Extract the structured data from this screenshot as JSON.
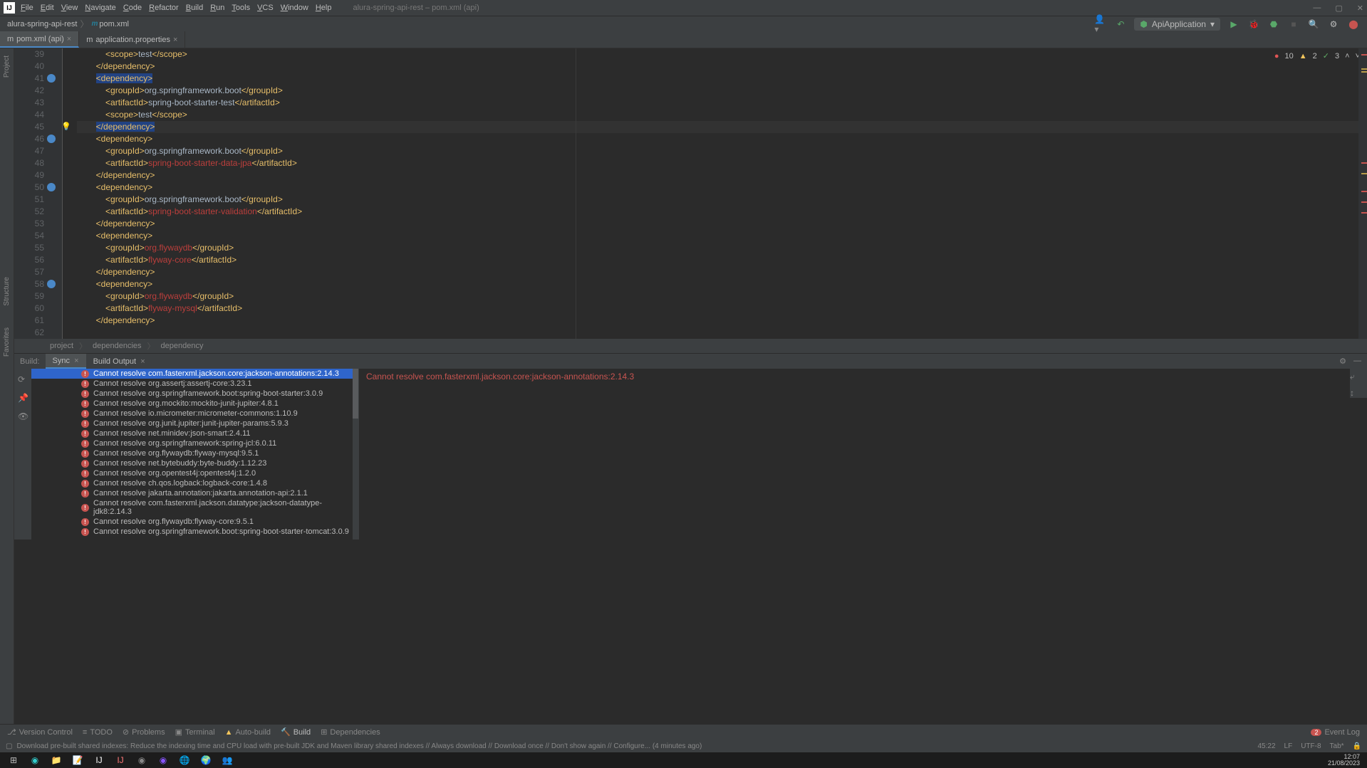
{
  "menus": [
    "File",
    "Edit",
    "View",
    "Navigate",
    "Code",
    "Refactor",
    "Build",
    "Run",
    "Tools",
    "VCS",
    "Window",
    "Help"
  ],
  "window_title": "alura-spring-api-rest – pom.xml (api)",
  "breadcrumb": {
    "project": "alura-spring-api-rest",
    "file": "pom.xml"
  },
  "run_config": "ApiApplication",
  "tabs": [
    {
      "label": "pom.xml (api)",
      "active": true
    },
    {
      "label": "application.properties",
      "active": false
    }
  ],
  "inspections": {
    "errors": "10",
    "warnings": "2",
    "ok": "3"
  },
  "code_lines": [
    {
      "n": 39,
      "html": "            <span class='tag'>&lt;scope&gt;</span><span class='txt'>test</span><span class='tag'>&lt;/scope&gt;</span>"
    },
    {
      "n": 40,
      "html": "        <span class='tag'>&lt;/dependency&gt;</span>"
    },
    {
      "n": 41,
      "html": "        <span class='tag highlighted-tag'>&lt;dependency&gt;</span>",
      "gicon": true
    },
    {
      "n": 42,
      "html": "            <span class='tag'>&lt;groupId&gt;</span><span class='txt'>org.springframework.boot</span><span class='tag'>&lt;/groupId&gt;</span>"
    },
    {
      "n": 43,
      "html": "            <span class='tag'>&lt;artifactId&gt;</span><span class='txt'>spring-boot-starter-test</span><span class='tag'>&lt;/artifactId&gt;</span>"
    },
    {
      "n": 44,
      "html": "            <span class='tag'>&lt;scope&gt;</span><span class='txt'>test</span><span class='tag'>&lt;/scope&gt;</span>"
    },
    {
      "n": 45,
      "html": "        <span class='tag highlighted-tag'>&lt;/dependency&gt;</span>",
      "hl": true,
      "bulb": true
    },
    {
      "n": 46,
      "html": "        <span class='tag'>&lt;dependency&gt;</span>",
      "gicon": true
    },
    {
      "n": 47,
      "html": "            <span class='tag'>&lt;groupId&gt;</span><span class='txt'>org.springframework.boot</span><span class='tag'>&lt;/groupId&gt;</span>"
    },
    {
      "n": 48,
      "html": "            <span class='tag'>&lt;artifactId&gt;</span><span class='red'>spring-boot-starter-data-jpa</span><span class='tag'>&lt;/artifactId&gt;</span>"
    },
    {
      "n": 49,
      "html": "        <span class='tag'>&lt;/dependency&gt;</span>"
    },
    {
      "n": 50,
      "html": "        <span class='tag'>&lt;dependency&gt;</span>",
      "gicon": true
    },
    {
      "n": 51,
      "html": "            <span class='tag'>&lt;groupId&gt;</span><span class='txt'>org.springframework.boot</span><span class='tag'>&lt;/groupId&gt;</span>"
    },
    {
      "n": 52,
      "html": "            <span class='tag'>&lt;artifactId&gt;</span><span class='red'>spring-boot-starter-validation</span><span class='tag'>&lt;/artifactId&gt;</span>"
    },
    {
      "n": 53,
      "html": "        <span class='tag'>&lt;/dependency&gt;</span>"
    },
    {
      "n": 54,
      "html": "        <span class='tag'>&lt;dependency&gt;</span>"
    },
    {
      "n": 55,
      "html": "            <span class='tag'>&lt;groupId&gt;</span><span class='red'>org.flywaydb</span><span class='tag'>&lt;/groupId&gt;</span>"
    },
    {
      "n": 56,
      "html": "            <span class='tag'>&lt;artifactId&gt;</span><span class='red'>flyway-core</span><span class='tag'>&lt;/artifactId&gt;</span>"
    },
    {
      "n": 57,
      "html": "        <span class='tag'>&lt;/dependency&gt;</span>"
    },
    {
      "n": 58,
      "html": "        <span class='tag'>&lt;dependency&gt;</span>",
      "gicon": true
    },
    {
      "n": 59,
      "html": "            <span class='tag'>&lt;groupId&gt;</span><span class='red'>org.flywaydb</span><span class='tag'>&lt;/groupId&gt;</span>"
    },
    {
      "n": 60,
      "html": "            <span class='tag'>&lt;artifactId&gt;</span><span class='red'>flyway-mysql</span><span class='tag'>&lt;/artifactId&gt;</span>"
    },
    {
      "n": 61,
      "html": "        <span class='tag'>&lt;/dependency&gt;</span>"
    },
    {
      "n": 62,
      "html": ""
    }
  ],
  "code_breadcrumb": [
    "project",
    "dependencies",
    "dependency"
  ],
  "build_label": "Build:",
  "build_tabs": [
    "Sync",
    "Build Output"
  ],
  "build_errors": [
    "Cannot resolve com.fasterxml.jackson.core:jackson-annotations:2.14.3",
    "Cannot resolve org.assertj:assertj-core:3.23.1",
    "Cannot resolve org.springframework.boot:spring-boot-starter:3.0.9",
    "Cannot resolve org.mockito:mockito-junit-jupiter:4.8.1",
    "Cannot resolve io.micrometer:micrometer-commons:1.10.9",
    "Cannot resolve org.junit.jupiter:junit-jupiter-params:5.9.3",
    "Cannot resolve net.minidev:json-smart:2.4.11",
    "Cannot resolve org.springframework:spring-jcl:6.0.11",
    "Cannot resolve org.flywaydb:flyway-mysql:9.5.1",
    "Cannot resolve net.bytebuddy:byte-buddy:1.12.23",
    "Cannot resolve org.opentest4j:opentest4j:1.2.0",
    "Cannot resolve ch.qos.logback:logback-core:1.4.8",
    "Cannot resolve jakarta.annotation:jakarta.annotation-api:2.1.1",
    "Cannot resolve com.fasterxml.jackson.datatype:jackson-datatype-jdk8:2.14.3",
    "Cannot resolve org.flywaydb:flyway-core:9.5.1",
    "Cannot resolve org.springframework.boot:spring-boot-starter-tomcat:3.0.9"
  ],
  "build_detail": "Cannot resolve com.fasterxml.jackson.core:jackson-annotations:2.14.3",
  "bottom_tools": {
    "vc": "Version Control",
    "todo": "TODO",
    "problems": "Problems",
    "terminal": "Terminal",
    "autobuild": "Auto-build",
    "build": "Build",
    "deps": "Dependencies",
    "eventlog": "Event Log",
    "eventlog_count": "2"
  },
  "status_message": "Download pre-built shared indexes: Reduce the indexing time and CPU load with pre-built JDK and Maven library shared indexes // Always download // Download once // Don't show again // Configure... (4 minutes ago)",
  "status_right": {
    "pos": "45:22",
    "lf": "LF",
    "enc": "UTF-8",
    "tab": "Tab*"
  },
  "clock": {
    "time": "12:07",
    "date": "21/08/2023"
  },
  "left_labels": {
    "project": "Project",
    "structure": "Structure",
    "favorites": "Favorites"
  }
}
